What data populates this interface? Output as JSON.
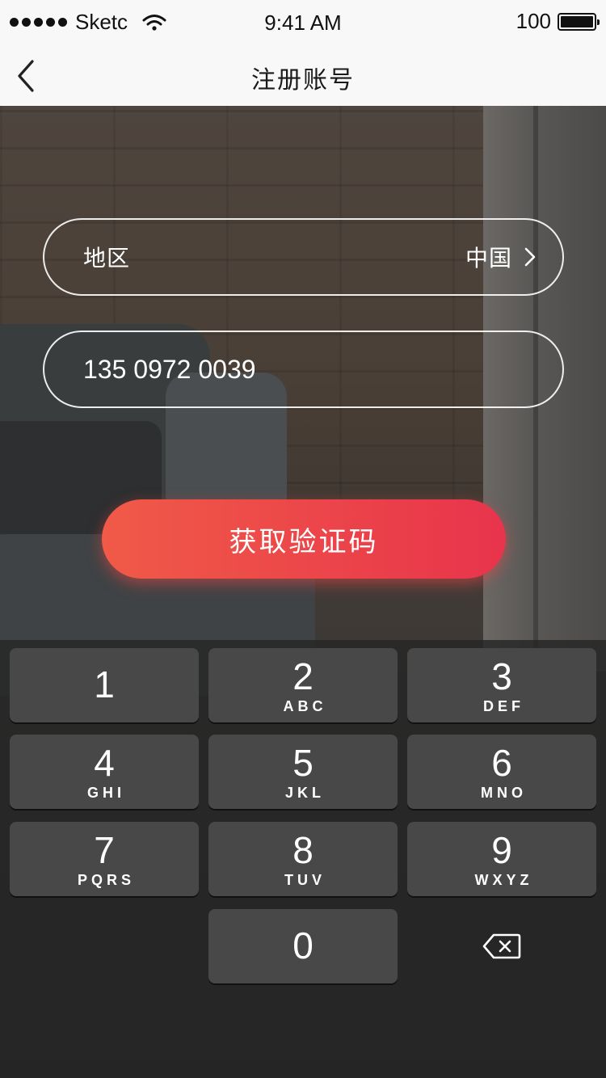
{
  "status_bar": {
    "carrier": "Sketc",
    "time": "9:41 AM",
    "battery": "100"
  },
  "nav": {
    "title": "注册账号",
    "back_icon": "chevron-left-icon"
  },
  "form": {
    "region_label": "地区",
    "region_value": "中国",
    "phone_value": "135 0972 0039"
  },
  "cta": {
    "label": "获取验证码",
    "gradient_start": "#f05a47",
    "gradient_end": "#e8344c"
  },
  "keypad": {
    "keys": [
      {
        "num": "1",
        "letters": ""
      },
      {
        "num": "2",
        "letters": "ABC"
      },
      {
        "num": "3",
        "letters": "DEF"
      },
      {
        "num": "4",
        "letters": "GHI"
      },
      {
        "num": "5",
        "letters": "JKL"
      },
      {
        "num": "6",
        "letters": "MNO"
      },
      {
        "num": "7",
        "letters": "PQRS"
      },
      {
        "num": "8",
        "letters": "TUV"
      },
      {
        "num": "9",
        "letters": "WXYZ"
      },
      {
        "num": "0",
        "letters": ""
      }
    ],
    "delete_icon": "backspace-icon"
  }
}
